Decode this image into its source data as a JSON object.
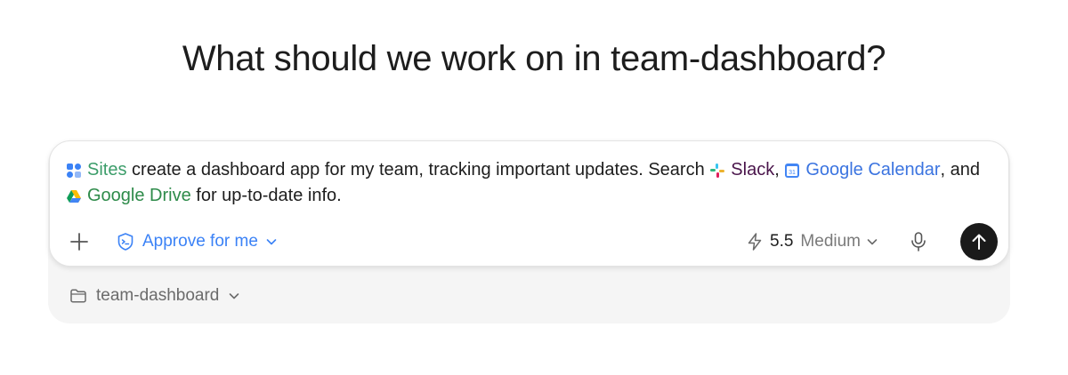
{
  "title": "What should we work on in team-dashboard?",
  "composer": {
    "chips": {
      "sites": "Sites",
      "slack": "Slack",
      "google_calendar": "Google Calendar",
      "google_drive": "Google Drive"
    },
    "text": {
      "part1": "create a dashboard app for my team, tracking important updates. Search",
      "comma1": ",",
      "part2": ", and",
      "part3": "for up-to-date info."
    },
    "toolbar": {
      "add_icon": "plus-icon",
      "approve_label": "Approve for me",
      "model_version": "5.5",
      "model_effort": "Medium",
      "mic_icon": "microphone-icon",
      "send_icon": "arrow-up-icon"
    }
  },
  "workspace": {
    "label": "team-dashboard",
    "icon": "folder-icon"
  },
  "colors": {
    "accent_blue": "#3b82f6",
    "send_button": "#1a1a1a",
    "tray_background": "#f5f5f5"
  }
}
